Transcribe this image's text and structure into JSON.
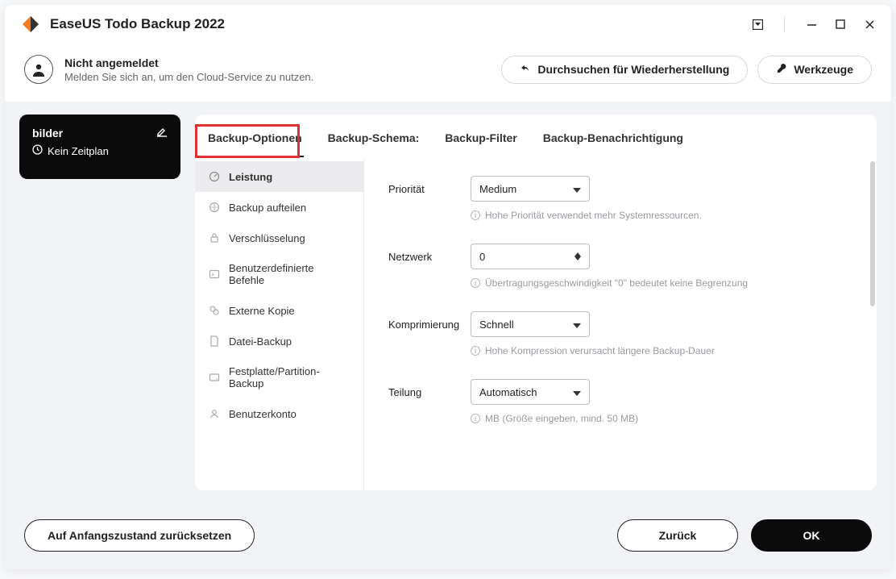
{
  "app": {
    "title": "EaseUS Todo Backup 2022"
  },
  "header": {
    "user_line1": "Nicht angemeldet",
    "user_line2": "Melden Sie sich an, um den Cloud-Service zu nutzen.",
    "browse_btn": "Durchsuchen für Wiederherstellung",
    "tools_btn": "Werkzeuge"
  },
  "task_card": {
    "title": "bilder",
    "schedule": "Kein Zeitplan"
  },
  "tabs": {
    "options": "Backup-Optionen",
    "schema": "Backup-Schema:",
    "filter": "Backup-Filter",
    "notification": "Backup-Benachrichtigung"
  },
  "side": {
    "performance": "Leistung",
    "split": "Backup aufteilen",
    "encryption": "Verschlüsselung",
    "custom_cmd": "Benutzerdefinierte Befehle",
    "offsite": "Externe Kopie",
    "file_backup": "Datei-Backup",
    "disk_backup": "Festplatte/Partition-Backup",
    "account": "Benutzerkonto"
  },
  "form": {
    "priority": {
      "label": "Priorität",
      "value": "Medium",
      "hint": "Hohe Priorität verwendet mehr Systemressourcen."
    },
    "network": {
      "label": "Netzwerk",
      "value": "0",
      "hint": "Übertragungsgeschwindigkeit \"0\" bedeutet keine Begrenzung"
    },
    "compression": {
      "label": "Komprimierung",
      "value": "Schnell",
      "hint": "Hohe Kompression verursacht längere Backup-Dauer"
    },
    "splitting": {
      "label": "Teilung",
      "value": "Automatisch",
      "hint": "MB (Größe eingeben, mind. 50 MB)"
    }
  },
  "footer": {
    "reset": "Auf Anfangszustand zurücksetzen",
    "back": "Zurück",
    "ok": "OK"
  }
}
